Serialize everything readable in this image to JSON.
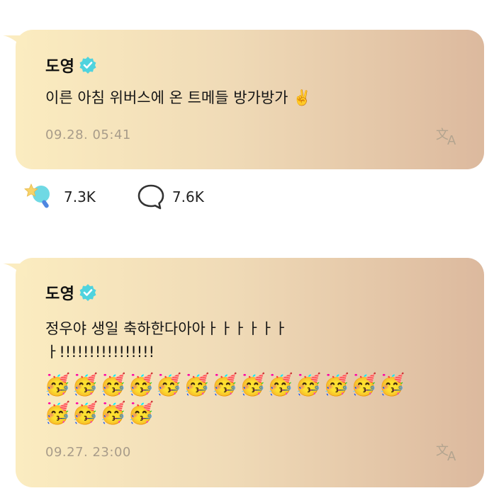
{
  "posts": [
    {
      "author": "도영",
      "message_lines": [
        "이른 아침 위버스에 온 트메들 방가방가 ✌️"
      ],
      "emoji_lines": [],
      "timestamp": "09.28. 05:41",
      "translate_icon": "translate-icon",
      "reactions": {
        "likes": "7.3K",
        "comments": "7.6K"
      }
    },
    {
      "author": "도영",
      "message_lines": [
        "정우야 생일 축하한다아아ㅏㅏㅏㅏㅏㅏ",
        "ㅏ!!!!!!!!!!!!!!!!"
      ],
      "emoji_lines": [
        "🥳🥳🥳🥳🥳🥳🥳🥳🥳🥳🥳🥳🥳",
        "🥳🥳🥳🥳"
      ],
      "timestamp": "09.27. 23:00",
      "translate_icon": "translate-icon"
    }
  ],
  "colors": {
    "bubble_start": "#fbecc0",
    "bubble_end": "#dcb99e",
    "verified": "#4fd3de",
    "timestamp": "#a89c8a"
  }
}
